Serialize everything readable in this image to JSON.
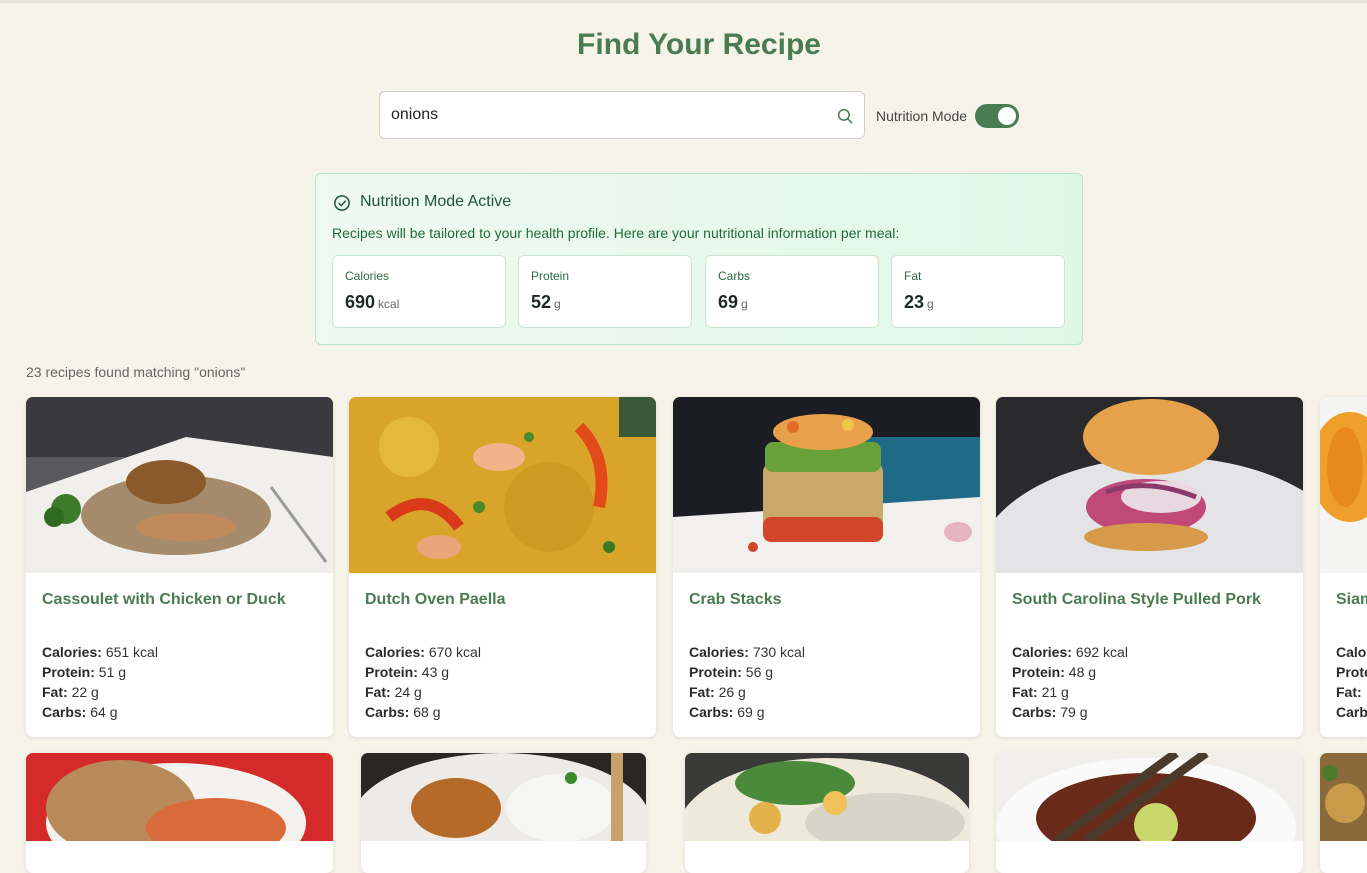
{
  "page": {
    "title": "Find Your Recipe"
  },
  "search": {
    "value": "onions",
    "icon": "search-icon"
  },
  "nutrition_toggle": {
    "label": "Nutrition Mode",
    "on": true
  },
  "nutrition_panel": {
    "title": "Nutrition Mode Active",
    "description": "Recipes will be tailored to your health profile. Here are your nutritional information per meal:",
    "icon": "check-circle-icon",
    "macros": [
      {
        "label": "Calories",
        "value": "690",
        "unit": "kcal"
      },
      {
        "label": "Protein",
        "value": "52",
        "unit": "g"
      },
      {
        "label": "Carbs",
        "value": "69",
        "unit": "g"
      },
      {
        "label": "Fat",
        "value": "23",
        "unit": "g"
      }
    ]
  },
  "results": {
    "summary": "23 recipes found matching \"onions\""
  },
  "stat_labels": {
    "calories": "Calories:",
    "protein": "Protein:",
    "fat": "Fat:",
    "carbs": "Carbs:"
  },
  "recipes": [
    {
      "title": "Cassoulet with Chicken or Duck",
      "calories": "651 kcal",
      "protein": "51 g",
      "fat": "22 g",
      "carbs": "64 g"
    },
    {
      "title": "Dutch Oven Paella",
      "calories": "670 kcal",
      "protein": "43 g",
      "fat": "24 g",
      "carbs": "68 g"
    },
    {
      "title": "Crab Stacks",
      "calories": "730 kcal",
      "protein": "56 g",
      "fat": "26 g",
      "carbs": "69 g"
    },
    {
      "title": "South Carolina Style Pulled Pork",
      "calories": "692 kcal",
      "protein": "48 g",
      "fat": "21 g",
      "carbs": "79 g"
    },
    {
      "title": "Siam",
      "calories": "",
      "protein": "",
      "fat": "",
      "carbs": ""
    }
  ],
  "colors": {
    "accent": "#4a7c52",
    "background": "#f6f3e9",
    "panel_border": "#b7e6c4"
  }
}
